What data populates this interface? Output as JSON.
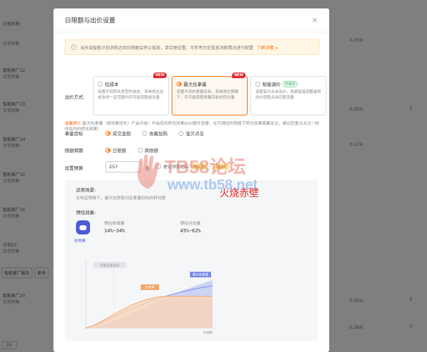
{
  "background": {
    "left_rows": [
      {
        "title": "计划名称",
        "sub": ""
      },
      {
        "title": "日常销售",
        "sub": ""
      },
      {
        "title": "智能推广12",
        "sub": "日常销售"
      },
      {
        "title": "智能推广13",
        "sub": "日常销售"
      },
      {
        "title": "智能推广14",
        "sub": "日常销售"
      },
      {
        "title": "智能推广15",
        "sub": "日常销售"
      },
      {
        "title": "智能推广16",
        "sub": "日常销售"
      },
      {
        "title": "智能推广20",
        "sub": "日常销售"
      },
      {
        "title": "计划20",
        "sub": "日常销售"
      }
    ],
    "right_values": [
      "0.25元",
      "0.25元",
      "0.12元",
      "0.30元",
      "0.28元"
    ],
    "right_counts": [
      "2",
      "2",
      "3"
    ],
    "buttons": [
      "智能推广报告",
      "更多"
    ],
    "pager_size": "20"
  },
  "modal": {
    "title": "日限额与出价设置",
    "close": "×",
    "notice_text": "当天该智能计划消耗达到日限额会停止投放，请合理设置；可参考历史投放消耗情况进行配置",
    "notice_link": "了解详情 >",
    "bid_label": "出价方式:",
    "strategies": [
      {
        "title": "控成本",
        "desc": "设置不同转化类型的成本，系统将在此成本的一定范围内尽可能获取成交量",
        "badge": "NEW",
        "tag": ""
      },
      {
        "title": "最大化拿量",
        "desc": "设置不同的拿量目标，系统将在预算下，尽可能获取拿量目标的转化量",
        "badge": "NEW",
        "tag": ""
      },
      {
        "title": "智能调价",
        "desc": "设置每次点击出价，系统智能调整最终出价获取点击匹配流量",
        "badge": "",
        "tag": "升级中"
      }
    ],
    "tip_prefix": "温馨提示:",
    "tip_text": "最大化拿量（原效果优先）产品升级！升级后的转化效果&roi提升显著，在可调控的预算下转化效果需要关注，建议您重点关注一段时间内的转化效果！",
    "goal_label": "拿量目标",
    "goal_options": [
      "成交金额",
      "收藏加购",
      "宝贝点击"
    ],
    "period_label": "限额周期",
    "period_options": [
      "日限额",
      "周限额"
    ],
    "budget_label": "设置预算",
    "budget_value": "257",
    "budget_unit": "元",
    "suggest_text": "建议预算范围",
    "suggest_range_a": "299元",
    "suggest_range_b": "399元",
    "panel": {
      "scene_title": "适用场景:",
      "scene_desc": "在特定预算下，最大化获取对应拿量目标的转化数",
      "effect_title": "预估效果:",
      "robot_label": "非常棒",
      "metric1_label": "预估新增量",
      "metric1_value": "14%~34%",
      "metric2_label": "预估点击量",
      "metric2_value": "45%~62%",
      "chart_legend_top": "预算设置范围",
      "series_cost": "控成本",
      "series_max": "最大化拿量",
      "xaxis_label": "日预算"
    }
  },
  "watermark": {
    "line1": "TB58论坛",
    "line2": "www.tb58.net",
    "line3": "火烧赤壁"
  },
  "colors": {
    "accent": "#ff6a00",
    "new_badge": "#e4242b",
    "series_max": "#7b8be6",
    "series_cost": "#f5a46b"
  }
}
